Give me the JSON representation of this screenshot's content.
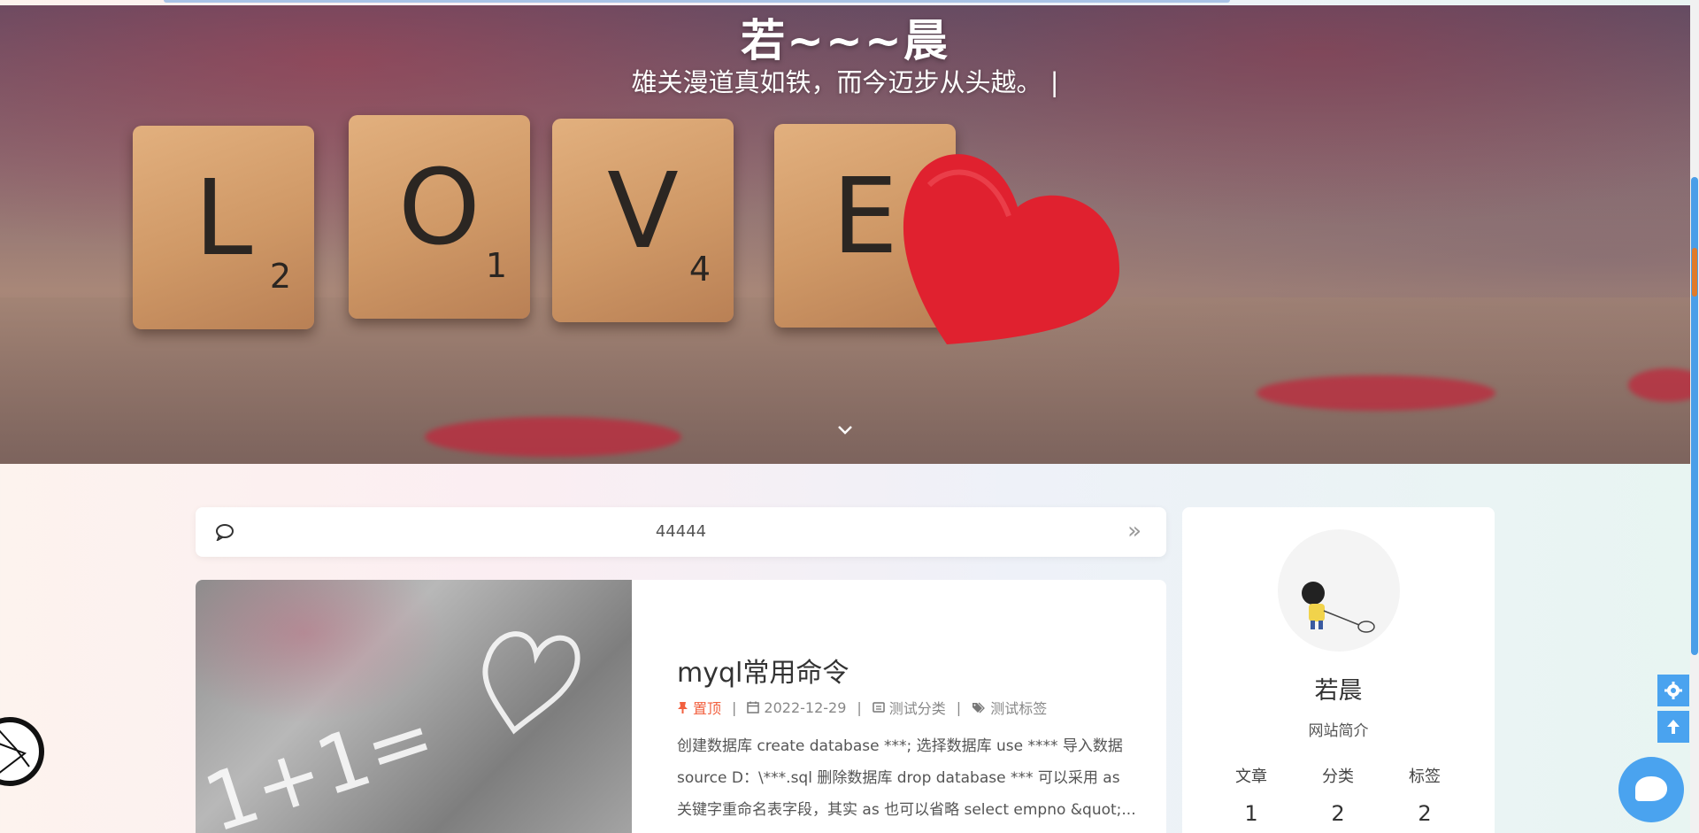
{
  "hero": {
    "title": "若~~~晨",
    "subtitle": "雄关漫道真如铁，而今迈步从头越。 |",
    "tiles": [
      {
        "letter": "L",
        "num": "2"
      },
      {
        "letter": "O",
        "num": "1"
      },
      {
        "letter": "V",
        "num": "4"
      },
      {
        "letter": "E",
        "num": ""
      }
    ]
  },
  "notice": {
    "text": "44444",
    "arrow": "»"
  },
  "post": {
    "title": "myql常用命令",
    "pinned_label": "置顶",
    "date": "2022-12-29",
    "category": "测试分类",
    "tag": "测试标签",
    "excerpt": "创建数据库 create database ***; 选择数据库 use **** 导入数据 source D：\\***.sql 删除数据库 drop database *** 可以采用 as 关键字重命名表字段，其实 as 也可以省略 select empno &quot;..."
  },
  "profile": {
    "name": "若晨",
    "description": "网站简介",
    "stats": [
      {
        "label": "文章",
        "value": "1"
      },
      {
        "label": "分类",
        "value": "2"
      },
      {
        "label": "标签",
        "value": "2"
      }
    ]
  },
  "colors": {
    "accent": "#4aa3ef",
    "pinned": "#f2603f"
  },
  "icons": {
    "notice": "speech-bubble-icon",
    "settings": "gear-icon",
    "to_top": "arrow-up-icon",
    "chat": "chat-icon"
  }
}
